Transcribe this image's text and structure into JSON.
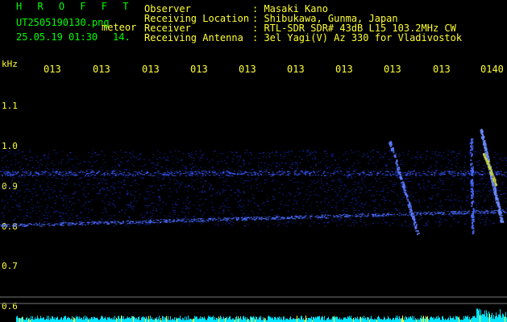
{
  "header": {
    "brand": "H R O F F T",
    "filename": "UT2505190130.png",
    "mode": "meteor",
    "datetime": "25.05.19 01:30",
    "minute": "14."
  },
  "station": [
    {
      "label": "Observer",
      "value": ": Masaki Kano"
    },
    {
      "label": "Receiving Location",
      "value": ": Shibukawa, Gunma, Japan"
    },
    {
      "label": "Receiver",
      "value": ": RTL-SDR SDR# 43dB L15 103.2MHz CW"
    },
    {
      "label": "Receiving Antenna",
      "value": ": 3el Yagi(V) Az 330 for Vladivostok"
    }
  ],
  "axis": {
    "unit": "kHz",
    "time_ticks": [
      "013",
      "013",
      "013",
      "013",
      "013",
      "013",
      "013",
      "013",
      "013",
      "0140"
    ],
    "freq_ticks": [
      "1.1",
      "1.0",
      "0.9",
      "0.8",
      "0.7",
      "0.6"
    ]
  },
  "colors": {
    "header_label": "#ffff33",
    "brand": "#00ff00",
    "echo": "#3050ff",
    "noise_bar": "#00e5ff"
  }
}
